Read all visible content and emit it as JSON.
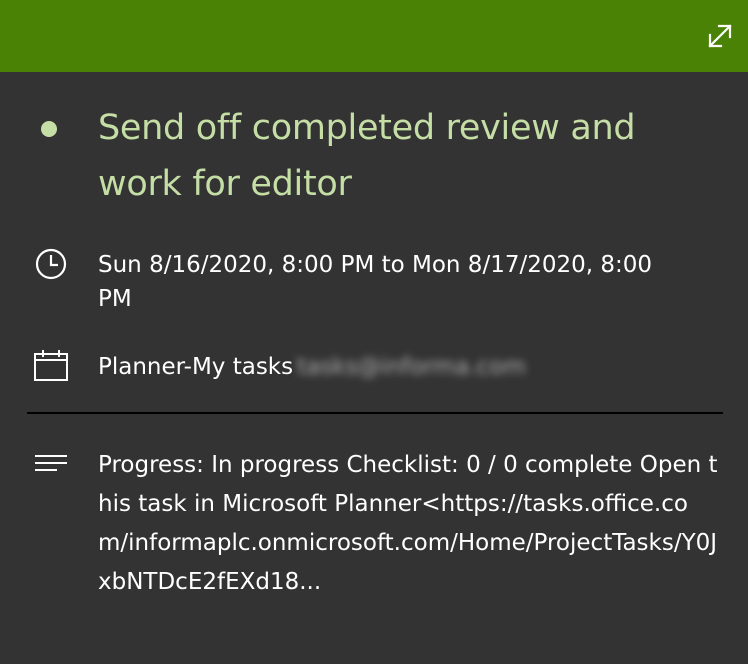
{
  "header": {
    "color": "#498205",
    "expand_icon": "expand-icon"
  },
  "task": {
    "status_icon": "bullet-dot-icon",
    "title": "Send off completed review and work for editor",
    "title_color": "#c5dea5"
  },
  "time": {
    "icon": "clock-icon",
    "text": "Sun 8/16/2020, 8:00 PM to Mon 8/17/2020, 8:00 PM"
  },
  "calendar": {
    "icon": "calendar-icon",
    "label": "Planner-My tasks",
    "email_redacted": "tasks@informa.com"
  },
  "notes": {
    "icon": "notes-lines-icon",
    "text": "Progress: In progress Checklist: 0 / 0 complete Open this task in Microsoft Planner<https://tasks.office.com/informaplc.onmicrosoft.com/Home/ProjectTasks/Y0JxbNTDcE2fEXd18..."
  }
}
